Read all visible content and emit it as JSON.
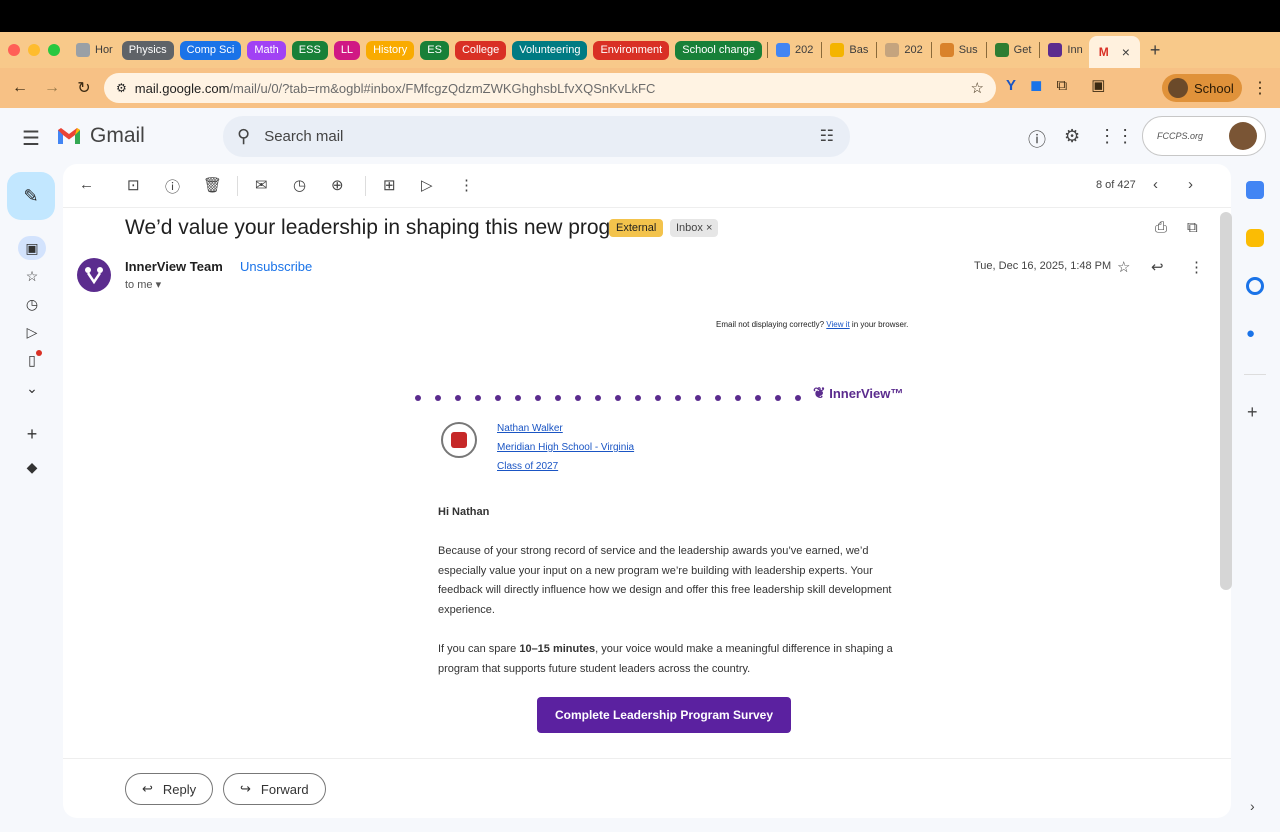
{
  "browser": {
    "tabs": [
      {
        "label": "Hor",
        "type": "tab"
      },
      {
        "label": "Physics",
        "type": "group",
        "color": "#5f6368"
      },
      {
        "label": "Comp Sci",
        "type": "group",
        "color": "#1a73e8"
      },
      {
        "label": "Math",
        "type": "group",
        "color": "#a142f4"
      },
      {
        "label": "ESS",
        "type": "group",
        "color": "#188038"
      },
      {
        "label": "LL",
        "type": "group",
        "color": "#d01884"
      },
      {
        "label": "History",
        "type": "group",
        "color": "#f9ab00"
      },
      {
        "label": "ES",
        "type": "group",
        "color": "#188038"
      },
      {
        "label": "College",
        "type": "group",
        "color": "#d93025"
      },
      {
        "label": "Volunteering",
        "type": "group",
        "color": "#007b83"
      },
      {
        "label": "Environment",
        "type": "group",
        "color": "#d93025"
      },
      {
        "label": "School change",
        "type": "group",
        "color": "#188038"
      },
      {
        "label": "202",
        "type": "tab"
      },
      {
        "label": "Bas",
        "type": "tab"
      },
      {
        "label": "202",
        "type": "tab"
      },
      {
        "label": "Sus",
        "type": "tab"
      },
      {
        "label": "Get",
        "type": "tab"
      },
      {
        "label": "Inn",
        "type": "tab"
      }
    ],
    "active_tab_close": "×",
    "new_tab": "+",
    "url_host": "mail.google.com",
    "url_path": "/mail/u/0/?tab=rm&ogbl#inbox/FMfcgzQdzmZWKGhghsbLfvXQSnKvLkFC",
    "profile_label": "School"
  },
  "gmail": {
    "logo_text": "Gmail",
    "search_placeholder": "Search mail",
    "account_org": "FCCPS.org"
  },
  "toolbar": {
    "counter": "8 of 427"
  },
  "message": {
    "subject": "We’d value your leadership in shaping this new program",
    "badge_external": "External",
    "badge_inbox": "Inbox ×",
    "sender": "InnerView Team",
    "unsubscribe": "Unsubscribe",
    "to": "to me ▾",
    "date": "Tue, Dec 16, 2025, 1:48 PM"
  },
  "email_body": {
    "note_prefix": "Email not displaying correctly? ",
    "note_link": "View it",
    "note_suffix": " in your browser.",
    "logo_text": "InnerView™",
    "student_name": "Nathan Walker",
    "school": "Meridian High School - Virginia",
    "class": "Class of 2027",
    "greeting": "Hi Nathan",
    "para1": "Because of your strong record of service and the leadership awards you’ve earned, we’d especially value your input on a new program we’re building with leadership experts. Your feedback will directly influence how we design and offer this free leadership skill development experience.",
    "para2_prefix": "If you can spare ",
    "para2_bold": "10–15 minutes",
    "para2_suffix": ", your voice would make a meaningful difference in shaping a program that supports future student leaders across the country.",
    "cta": "Complete Leadership Program Survey"
  },
  "actions": {
    "reply": "Reply",
    "forward": "Forward"
  }
}
